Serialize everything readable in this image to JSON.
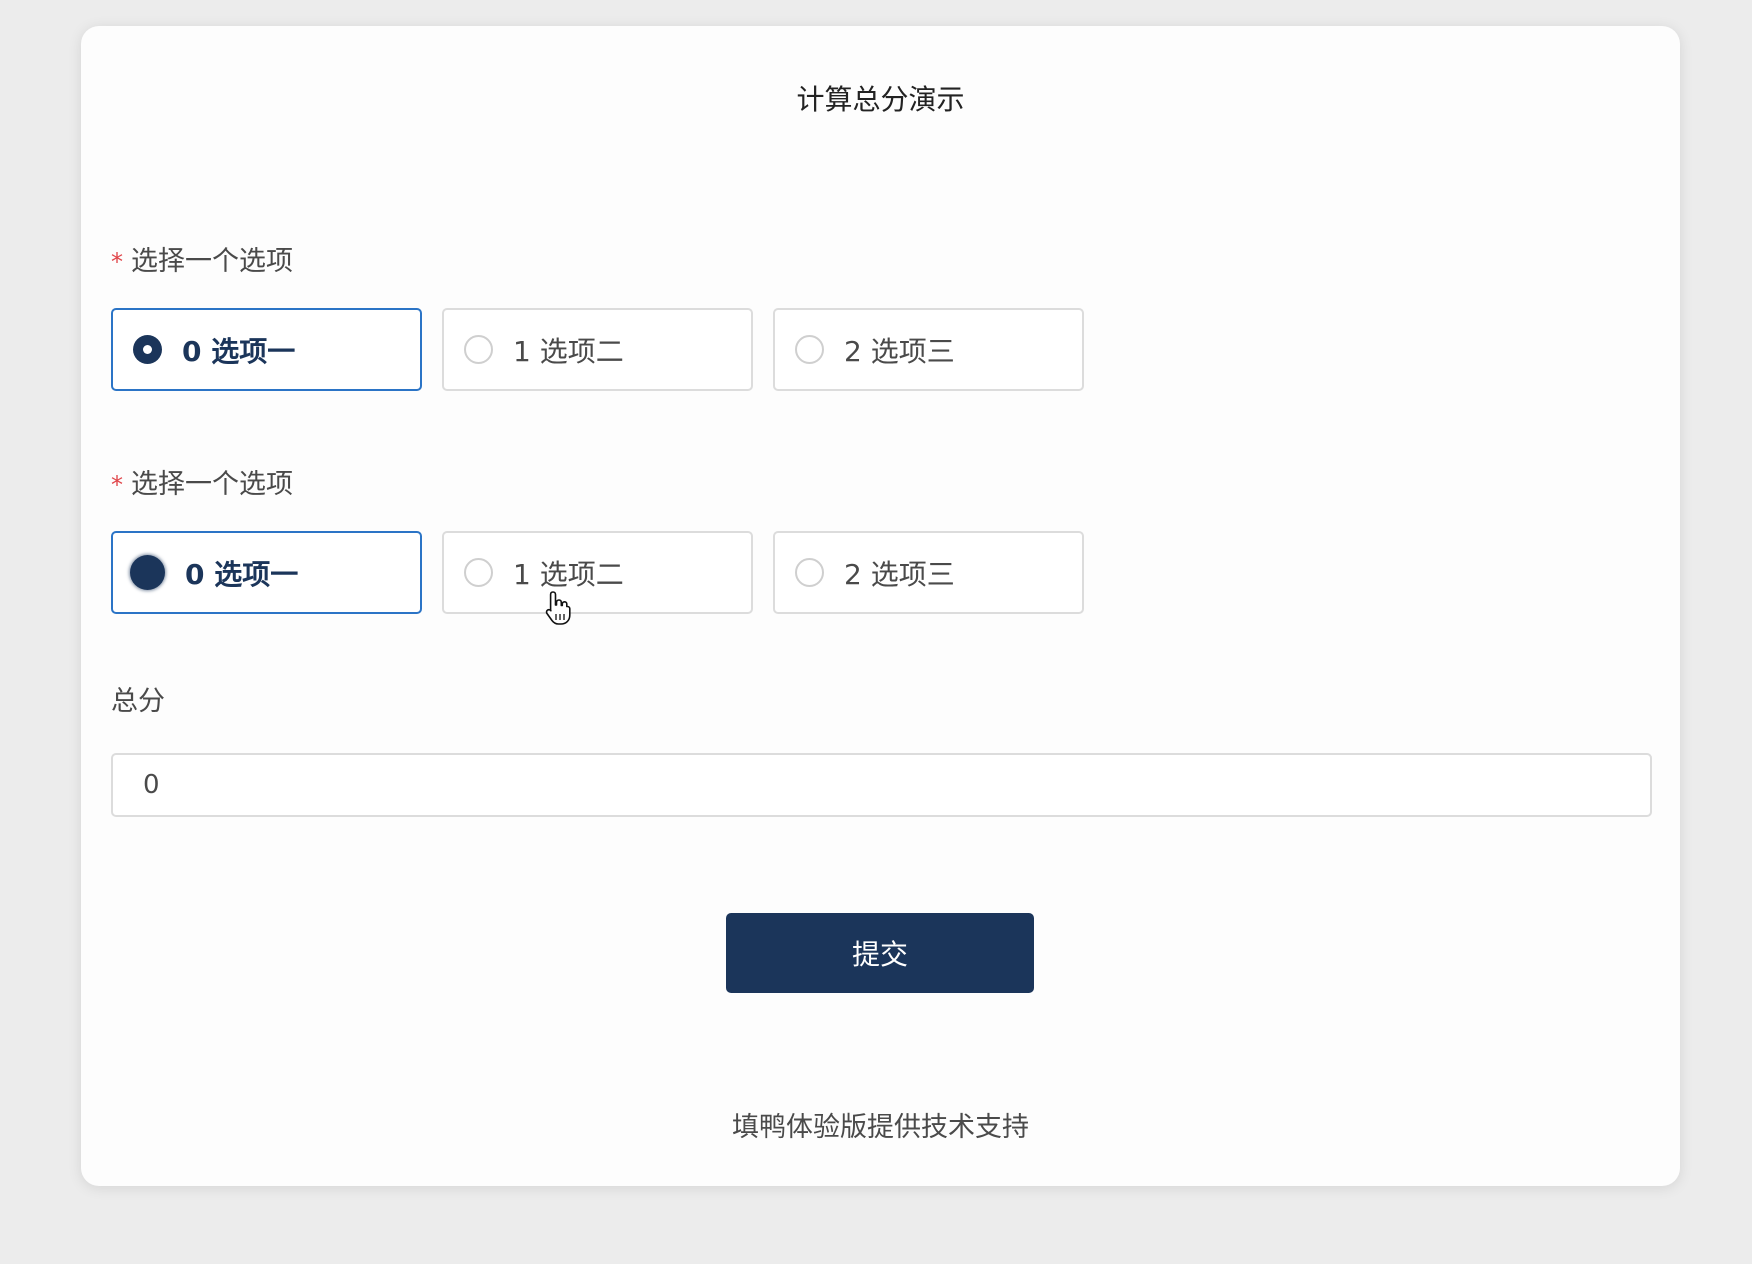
{
  "form": {
    "title": "计算总分演示",
    "questions": [
      {
        "required_mark": "*",
        "label": "选择一个选项",
        "options": [
          {
            "label": "0 选项一",
            "selected": true
          },
          {
            "label": "1 选项二",
            "selected": false
          },
          {
            "label": "2 选项三",
            "selected": false
          }
        ]
      },
      {
        "required_mark": "*",
        "label": "选择一个选项",
        "options": [
          {
            "label": "0 选项一",
            "selected": true
          },
          {
            "label": "1 选项二",
            "selected": false
          },
          {
            "label": "2 选项三",
            "selected": false
          }
        ]
      }
    ],
    "total": {
      "label": "总分",
      "value": "0"
    },
    "submit_label": "提交",
    "footer": "填鸭体验版提供技术支持"
  },
  "colors": {
    "accent": "#1b355a",
    "selected_border": "#2b74c6",
    "required": "#e0454a",
    "background": "#ececec",
    "card": "#fdfdfd"
  },
  "icons": {
    "cursor": "hand-pointer-icon"
  }
}
